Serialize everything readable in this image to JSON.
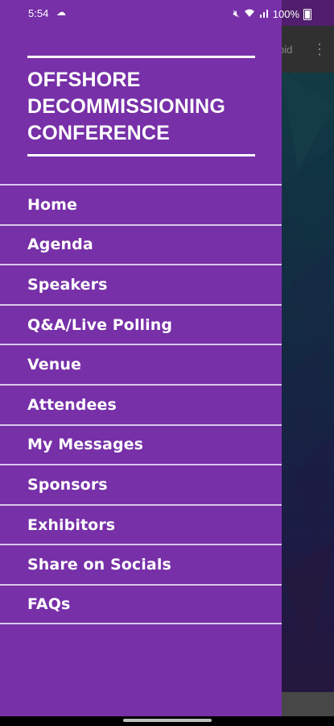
{
  "status_bar": {
    "time": "5:54",
    "battery": "100%"
  },
  "background_app": {
    "toolbar_fragment": "oid"
  },
  "drawer": {
    "title_line1": "OFFSHORE",
    "title_line2": "DECOMMISSIONING",
    "title_line3": "CONFERENCE",
    "items": [
      {
        "label": "Home"
      },
      {
        "label": "Agenda"
      },
      {
        "label": "Speakers"
      },
      {
        "label": "Q&A/Live Polling"
      },
      {
        "label": "Venue"
      },
      {
        "label": "Attendees"
      },
      {
        "label": "My Messages"
      },
      {
        "label": "Sponsors"
      },
      {
        "label": "Exhibitors"
      },
      {
        "label": "Share on Socials"
      },
      {
        "label": "FAQs"
      }
    ]
  },
  "colors": {
    "drawer_bg": "#7730a8",
    "divider": "#d9c8ea",
    "text": "#ffffff"
  }
}
